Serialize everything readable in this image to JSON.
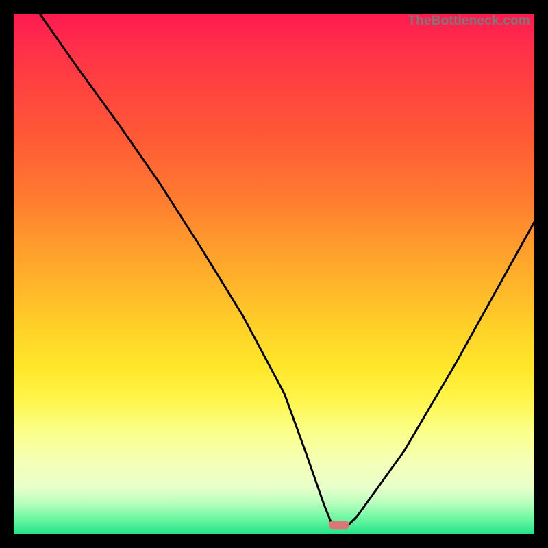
{
  "watermark": "TheBottleneck.com",
  "chart_data": {
    "type": "line",
    "title": "",
    "xlabel": "",
    "ylabel": "",
    "xlim": [
      0,
      100
    ],
    "ylim": [
      0,
      100
    ],
    "grid": false,
    "series": [
      {
        "name": "bottleneck-curve",
        "x": [
          5,
          12,
          20,
          28,
          36,
          44,
          52,
          56,
          59.5,
          61,
          63,
          64.5,
          66,
          75,
          85,
          100
        ],
        "y": [
          100,
          90,
          79,
          67.5,
          55,
          42,
          27,
          16,
          6,
          2.2,
          1.8,
          2.0,
          3.5,
          16,
          33,
          60
        ]
      }
    ],
    "marker": {
      "name": "optimal-point",
      "x_range": [
        60.5,
        64.5
      ],
      "y": 1.8,
      "color": "#d87878"
    },
    "colors": {
      "curve": "#000000",
      "marker": "#d87878"
    }
  }
}
